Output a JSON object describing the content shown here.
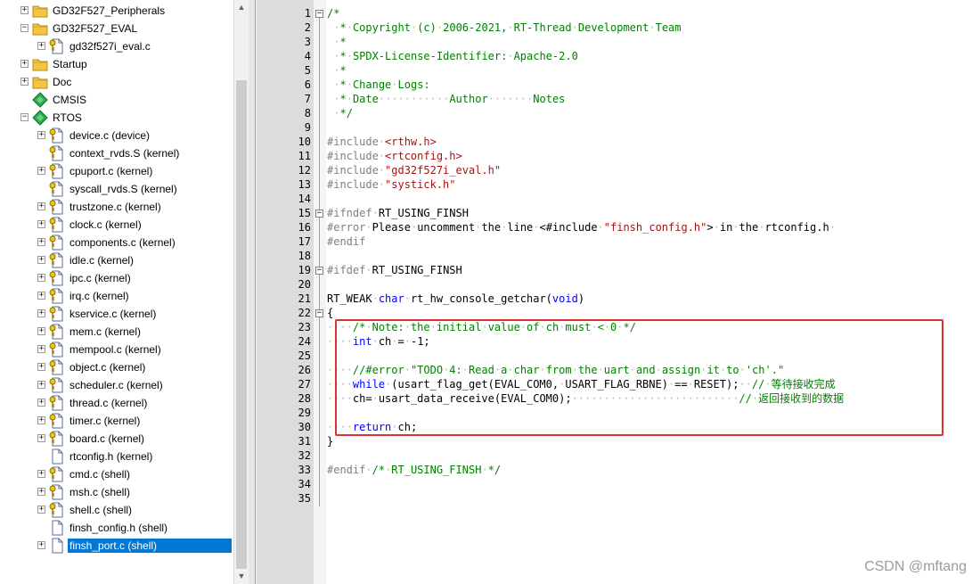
{
  "tree": [
    {
      "label": "GD32F527_Peripherals",
      "expander": "+",
      "icon": "folder",
      "indent": 0
    },
    {
      "label": "GD32F527_EVAL",
      "expander": "-",
      "icon": "folder",
      "indent": 0
    },
    {
      "label": "gd32f527i_eval.c",
      "expander": "+",
      "icon": "file-key",
      "indent": 1
    },
    {
      "label": "Startup",
      "expander": "+",
      "icon": "folder",
      "indent": 0
    },
    {
      "label": "Doc",
      "expander": "+",
      "icon": "folder",
      "indent": 0
    },
    {
      "label": "CMSIS",
      "expander": "",
      "icon": "component",
      "indent": 0
    },
    {
      "label": "RTOS",
      "expander": "-",
      "icon": "component",
      "indent": 0
    },
    {
      "label": "device.c (device)",
      "expander": "+",
      "icon": "file-key",
      "indent": 1
    },
    {
      "label": "context_rvds.S (kernel)",
      "expander": "",
      "icon": "file-key",
      "indent": 1
    },
    {
      "label": "cpuport.c (kernel)",
      "expander": "+",
      "icon": "file-key",
      "indent": 1
    },
    {
      "label": "syscall_rvds.S (kernel)",
      "expander": "",
      "icon": "file-key",
      "indent": 1
    },
    {
      "label": "trustzone.c (kernel)",
      "expander": "+",
      "icon": "file-key",
      "indent": 1
    },
    {
      "label": "clock.c (kernel)",
      "expander": "+",
      "icon": "file-key",
      "indent": 1
    },
    {
      "label": "components.c (kernel)",
      "expander": "+",
      "icon": "file-key",
      "indent": 1
    },
    {
      "label": "idle.c (kernel)",
      "expander": "+",
      "icon": "file-key",
      "indent": 1
    },
    {
      "label": "ipc.c (kernel)",
      "expander": "+",
      "icon": "file-key",
      "indent": 1
    },
    {
      "label": "irq.c (kernel)",
      "expander": "+",
      "icon": "file-key",
      "indent": 1
    },
    {
      "label": "kservice.c (kernel)",
      "expander": "+",
      "icon": "file-key",
      "indent": 1
    },
    {
      "label": "mem.c (kernel)",
      "expander": "+",
      "icon": "file-key",
      "indent": 1
    },
    {
      "label": "mempool.c (kernel)",
      "expander": "+",
      "icon": "file-key",
      "indent": 1
    },
    {
      "label": "object.c (kernel)",
      "expander": "+",
      "icon": "file-key",
      "indent": 1
    },
    {
      "label": "scheduler.c (kernel)",
      "expander": "+",
      "icon": "file-key",
      "indent": 1
    },
    {
      "label": "thread.c (kernel)",
      "expander": "+",
      "icon": "file-key",
      "indent": 1
    },
    {
      "label": "timer.c (kernel)",
      "expander": "+",
      "icon": "file-key",
      "indent": 1
    },
    {
      "label": "board.c (kernel)",
      "expander": "+",
      "icon": "file-key",
      "indent": 1
    },
    {
      "label": "rtconfig.h (kernel)",
      "expander": "",
      "icon": "file",
      "indent": 1
    },
    {
      "label": "cmd.c (shell)",
      "expander": "+",
      "icon": "file-key",
      "indent": 1
    },
    {
      "label": "msh.c (shell)",
      "expander": "+",
      "icon": "file-key",
      "indent": 1
    },
    {
      "label": "shell.c (shell)",
      "expander": "+",
      "icon": "file-key",
      "indent": 1
    },
    {
      "label": "finsh_config.h (shell)",
      "expander": "",
      "icon": "file",
      "indent": 1
    },
    {
      "label": "finsh_port.c (shell)",
      "expander": "+",
      "icon": "file",
      "indent": 1,
      "selected": true
    }
  ],
  "scrollbar": {
    "up_icon": "triangle-up-icon",
    "down_icon": "triangle-down-icon"
  },
  "fold_markers": {
    "1": "-",
    "15": "-",
    "19": "-",
    "22": "-"
  },
  "code": [
    [
      [
        "c",
        "/*"
      ]
    ],
    [
      [
        "c",
        " "
      ],
      [
        "w",
        "·"
      ],
      [
        "c",
        "*"
      ],
      [
        "w",
        "·"
      ],
      [
        "c",
        "Copyright"
      ],
      [
        "w",
        "·"
      ],
      [
        "c",
        "(c)"
      ],
      [
        "w",
        "·"
      ],
      [
        "c",
        "2006-2021,"
      ],
      [
        "w",
        "·"
      ],
      [
        "c",
        "RT-Thread"
      ],
      [
        "w",
        "·"
      ],
      [
        "c",
        "Development"
      ],
      [
        "w",
        "·"
      ],
      [
        "c",
        "Team"
      ]
    ],
    [
      [
        "c",
        " "
      ],
      [
        "w",
        "·"
      ],
      [
        "c",
        "*"
      ]
    ],
    [
      [
        "c",
        " "
      ],
      [
        "w",
        "·"
      ],
      [
        "c",
        "*"
      ],
      [
        "w",
        "·"
      ],
      [
        "c",
        "SPDX-License-Identifier:"
      ],
      [
        "w",
        "·"
      ],
      [
        "c",
        "Apache-2.0"
      ]
    ],
    [
      [
        "c",
        " "
      ],
      [
        "w",
        "·"
      ],
      [
        "c",
        "*"
      ]
    ],
    [
      [
        "c",
        " "
      ],
      [
        "w",
        "·"
      ],
      [
        "c",
        "*"
      ],
      [
        "w",
        "·"
      ],
      [
        "c",
        "Change"
      ],
      [
        "w",
        "·"
      ],
      [
        "c",
        "Logs:"
      ]
    ],
    [
      [
        "c",
        " "
      ],
      [
        "w",
        "·"
      ],
      [
        "c",
        "*"
      ],
      [
        "w",
        "·"
      ],
      [
        "c",
        "Date"
      ],
      [
        "w",
        "···········"
      ],
      [
        "c",
        "Author"
      ],
      [
        "w",
        "·······"
      ],
      [
        "c",
        "Notes"
      ]
    ],
    [
      [
        "c",
        " "
      ],
      [
        "w",
        "·"
      ],
      [
        "c",
        "*/"
      ]
    ],
    [],
    [
      [
        "p",
        "#include"
      ],
      [
        "w",
        "·"
      ],
      [
        "s",
        "<rthw.h>"
      ]
    ],
    [
      [
        "p",
        "#include"
      ],
      [
        "w",
        "·"
      ],
      [
        "s",
        "<rtconfig.h>"
      ]
    ],
    [
      [
        "p",
        "#include"
      ],
      [
        "w",
        "·"
      ],
      [
        "s",
        "\"gd32f527i_eval.h\""
      ]
    ],
    [
      [
        "p",
        "#include"
      ],
      [
        "w",
        "·"
      ],
      [
        "s",
        "\"systick.h\""
      ]
    ],
    [],
    [
      [
        "p",
        "#ifndef"
      ],
      [
        "w",
        "·"
      ],
      [
        "n",
        "RT_USING_FINSH"
      ]
    ],
    [
      [
        "p",
        "#error"
      ],
      [
        "w",
        "·"
      ],
      [
        "n",
        "Please"
      ],
      [
        "w",
        "·"
      ],
      [
        "n",
        "uncomment"
      ],
      [
        "w",
        "·"
      ],
      [
        "n",
        "the"
      ],
      [
        "w",
        "·"
      ],
      [
        "n",
        "line"
      ],
      [
        "w",
        "·"
      ],
      [
        "n",
        "<#include"
      ],
      [
        "w",
        "·"
      ],
      [
        "s",
        "\"finsh_config.h\""
      ],
      [
        "n",
        ">"
      ],
      [
        "w",
        "·"
      ],
      [
        "n",
        "in"
      ],
      [
        "w",
        "·"
      ],
      [
        "n",
        "the"
      ],
      [
        "w",
        "·"
      ],
      [
        "n",
        "rtconfig.h"
      ],
      [
        "w",
        "·"
      ]
    ],
    [
      [
        "p",
        "#endif"
      ]
    ],
    [],
    [
      [
        "p",
        "#ifdef"
      ],
      [
        "w",
        "·"
      ],
      [
        "n",
        "RT_USING_FINSH"
      ]
    ],
    [],
    [
      [
        "n",
        "RT_WEAK"
      ],
      [
        "w",
        "·"
      ],
      [
        "k",
        "char"
      ],
      [
        "w",
        "·"
      ],
      [
        "n",
        "rt_hw_console_getchar("
      ],
      [
        "k",
        "void"
      ],
      [
        "n",
        ")"
      ]
    ],
    [
      [
        "n",
        "{"
      ]
    ],
    [
      [
        "w",
        "····"
      ],
      [
        "c",
        "/*"
      ],
      [
        "w",
        "·"
      ],
      [
        "c",
        "Note:"
      ],
      [
        "w",
        "·"
      ],
      [
        "c",
        "the"
      ],
      [
        "w",
        "·"
      ],
      [
        "c",
        "initial"
      ],
      [
        "w",
        "·"
      ],
      [
        "c",
        "value"
      ],
      [
        "w",
        "·"
      ],
      [
        "c",
        "of"
      ],
      [
        "w",
        "·"
      ],
      [
        "c",
        "ch"
      ],
      [
        "w",
        "·"
      ],
      [
        "c",
        "must"
      ],
      [
        "w",
        "·"
      ],
      [
        "c",
        "<"
      ],
      [
        "w",
        "·"
      ],
      [
        "c",
        "0"
      ],
      [
        "w",
        "·"
      ],
      [
        "c",
        "*/"
      ]
    ],
    [
      [
        "w",
        "····"
      ],
      [
        "k",
        "int"
      ],
      [
        "w",
        "·"
      ],
      [
        "n",
        "ch"
      ],
      [
        "w",
        "·"
      ],
      [
        "n",
        "="
      ],
      [
        "w",
        "·"
      ],
      [
        "n",
        "-1;"
      ]
    ],
    [],
    [
      [
        "w",
        "····"
      ],
      [
        "c",
        "//#error"
      ],
      [
        "w",
        "·"
      ],
      [
        "c",
        "\"TODO"
      ],
      [
        "w",
        "·"
      ],
      [
        "c",
        "4:"
      ],
      [
        "w",
        "·"
      ],
      [
        "c",
        "Read"
      ],
      [
        "w",
        "·"
      ],
      [
        "c",
        "a"
      ],
      [
        "w",
        "·"
      ],
      [
        "c",
        "char"
      ],
      [
        "w",
        "·"
      ],
      [
        "c",
        "from"
      ],
      [
        "w",
        "·"
      ],
      [
        "c",
        "the"
      ],
      [
        "w",
        "·"
      ],
      [
        "c",
        "uart"
      ],
      [
        "w",
        "·"
      ],
      [
        "c",
        "and"
      ],
      [
        "w",
        "·"
      ],
      [
        "c",
        "assign"
      ],
      [
        "w",
        "·"
      ],
      [
        "c",
        "it"
      ],
      [
        "w",
        "·"
      ],
      [
        "c",
        "to"
      ],
      [
        "w",
        "·"
      ],
      [
        "c",
        "'ch'.\""
      ]
    ],
    [
      [
        "w",
        "····"
      ],
      [
        "k",
        "while"
      ],
      [
        "w",
        "·"
      ],
      [
        "n",
        "(usart_flag_get(EVAL_COM0,"
      ],
      [
        "w",
        "·"
      ],
      [
        "n",
        "USART_FLAG_RBNE)"
      ],
      [
        "w",
        "·"
      ],
      [
        "n",
        "=="
      ],
      [
        "w",
        "·"
      ],
      [
        "n",
        "RESET);"
      ],
      [
        "w",
        "··"
      ],
      [
        "c",
        "//"
      ],
      [
        "w",
        "·"
      ],
      [
        "c",
        "等待接收完成",
        "cjk"
      ]
    ],
    [
      [
        "w",
        "····"
      ],
      [
        "n",
        "ch="
      ],
      [
        "w",
        "·"
      ],
      [
        "n",
        "usart_data_receive(EVAL_COM0);"
      ],
      [
        "w",
        "··························"
      ],
      [
        "c",
        "//"
      ],
      [
        "w",
        "·"
      ],
      [
        "c",
        "返回接收到的数据",
        "cjk"
      ]
    ],
    [],
    [
      [
        "w",
        "····"
      ],
      [
        "k",
        "return"
      ],
      [
        "w",
        "·"
      ],
      [
        "n",
        "ch;"
      ]
    ],
    [
      [
        "n",
        "}"
      ]
    ],
    [],
    [
      [
        "p",
        "#endif"
      ],
      [
        "w",
        "·"
      ],
      [
        "c",
        "/*"
      ],
      [
        "w",
        "·"
      ],
      [
        "c",
        "RT_USING_FINSH"
      ],
      [
        "w",
        "·"
      ],
      [
        "c",
        "*/"
      ]
    ],
    [],
    []
  ],
  "watermark": "CSDN @mftang"
}
